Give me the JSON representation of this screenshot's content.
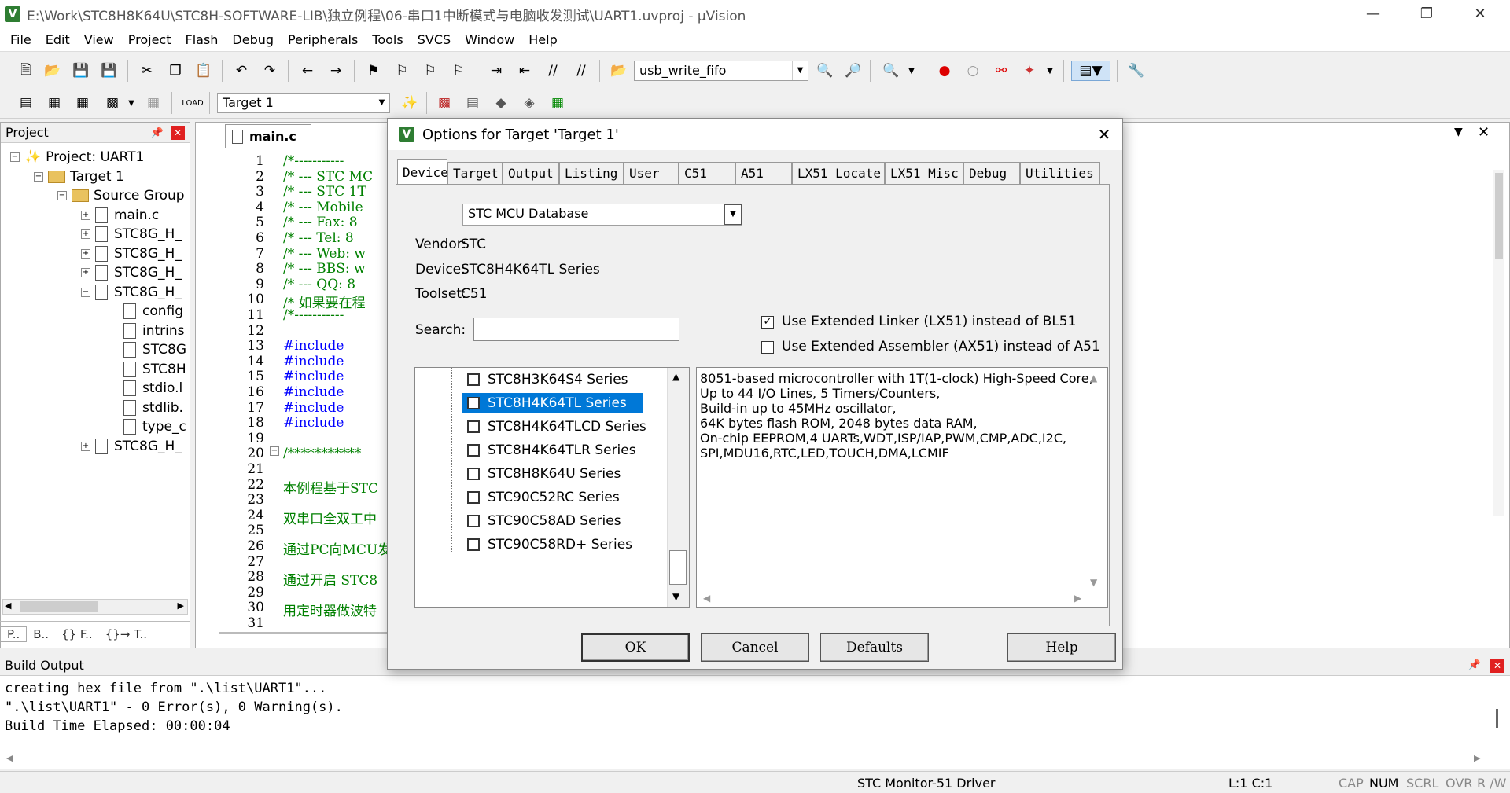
{
  "window": {
    "title": "E:\\Work\\STC8H8K64U\\STC8H-SOFTWARE-LIB\\独立例程\\06-串口1中断模式与电脑收发测试\\UART1.uvproj - µVision"
  },
  "menu": [
    "File",
    "Edit",
    "View",
    "Project",
    "Flash",
    "Debug",
    "Peripherals",
    "Tools",
    "SVCS",
    "Window",
    "Help"
  ],
  "toolbar": {
    "function_combo": "usb_write_fifo",
    "target_combo": "Target 1"
  },
  "project_panel": {
    "title": "Project",
    "root": "Project: UART1",
    "target": "Target 1",
    "group": "Source Group",
    "files": [
      "main.c",
      "STC8G_H_",
      "STC8G_H_",
      "STC8G_H_",
      "STC8G_H_"
    ],
    "subfiles": [
      "config",
      "intrins",
      "STC8G",
      "STC8H",
      "stdio.l",
      "stdlib.",
      "type_c"
    ],
    "last_file": "STC8G_H_",
    "tabs": [
      "P..",
      "B..",
      "{} F..",
      "{}→ T.."
    ]
  },
  "editor": {
    "tab": "main.c",
    "line_numbers": [
      "1",
      "2",
      "3",
      "4",
      "5",
      "6",
      "7",
      "8",
      "9",
      "10",
      "11",
      "12",
      "13",
      "14",
      "15",
      "16",
      "17",
      "18",
      "19",
      "20",
      "21",
      "22",
      "23",
      "24",
      "25",
      "26",
      "27",
      "28",
      "29",
      "30",
      "31"
    ],
    "lines": [
      "/*-----------",
      "/* --- STC MC",
      "/* --- STC 1T",
      "/* --- Mobile",
      "/* --- Fax: 8",
      "/* --- Tel: 8",
      "/* --- Web: w",
      "/* --- BBS: w",
      "/* --- QQ:  8",
      "/* 如果要在程",
      "/*-----------",
      "",
      "#include",
      "#include",
      "#include",
      "#include",
      "#include",
      "#include",
      "",
      "/***********",
      "",
      "本例程基于STC",
      "",
      "双串口全双工中",
      "",
      "通过PC向MCU发",
      "",
      "通过开启 STC8",
      "",
      "用定时器做波特"
    ]
  },
  "build_output": {
    "title": "Build Output",
    "lines": [
      "creating hex file from \".\\list\\UART1\"...",
      "\".\\list\\UART1\" - 0 Error(s), 0 Warning(s).",
      "Build Time Elapsed:  00:00:04"
    ]
  },
  "status_bar": {
    "driver": "STC Monitor-51 Driver",
    "position": "L:1 C:1",
    "cap": "CAP",
    "num": "NUM",
    "scrl": "SCRL",
    "ovr": "OVR",
    "rw": "R /W"
  },
  "dialog": {
    "title": "Options for Target 'Target 1'",
    "tabs": [
      "Device",
      "Target",
      "Output",
      "Listing",
      "User",
      "C51",
      "A51",
      "LX51 Locate",
      "LX51 Misc",
      "Debug",
      "Utilities"
    ],
    "active_tab": "Device",
    "database": "STC MCU Database",
    "vendor_label": "Vendor:",
    "vendor": "STC",
    "device_label": "Device:",
    "device": "STC8H4K64TL Series",
    "toolset_label": "Toolset:",
    "toolset": "C51",
    "search_label": "Search:",
    "search_value": "",
    "use_lx51": {
      "label": "Use Extended Linker (LX51) instead of BL51",
      "checked": true
    },
    "use_ax51": {
      "label": "Use Extended Assembler (AX51) instead of A51",
      "checked": false
    },
    "device_list": [
      {
        "name": "STC8H3K64S4 Series",
        "selected": false
      },
      {
        "name": "STC8H4K64TL Series",
        "selected": true
      },
      {
        "name": "STC8H4K64TLCD Series",
        "selected": false
      },
      {
        "name": "STC8H4K64TLR Series",
        "selected": false
      },
      {
        "name": "STC8H8K64U Series",
        "selected": false
      },
      {
        "name": "STC90C52RC Series",
        "selected": false
      },
      {
        "name": "STC90C58AD Series",
        "selected": false
      },
      {
        "name": "STC90C58RD+ Series",
        "selected": false
      }
    ],
    "description": [
      "8051-based microcontroller with 1T(1-clock) High-Speed Core,",
      "Up to 44 I/O Lines, 5 Timers/Counters,",
      "Build-in up to 45MHz oscillator,",
      "64K bytes flash ROM, 2048 bytes data RAM,",
      "On-chip EEPROM,4 UARTs,WDT,ISP/IAP,PWM,CMP,ADC,I2C,",
      "SPI,MDU16,RTC,LED,TOUCH,DMA,LCMIF"
    ],
    "buttons": {
      "ok": "OK",
      "cancel": "Cancel",
      "defaults": "Defaults",
      "help": "Help"
    }
  }
}
